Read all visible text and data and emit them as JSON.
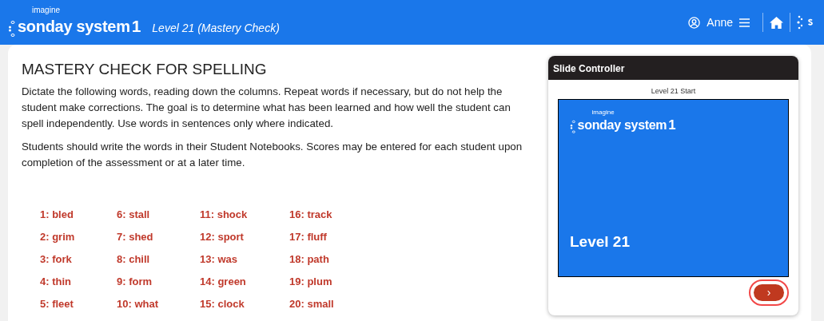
{
  "header": {
    "logo": {
      "tagline": "imagine",
      "name": "sonday system",
      "number": "1"
    },
    "subtitle": "Level 21 (Mastery Check)",
    "user": "Anne"
  },
  "main": {
    "title": "MASTERY CHECK FOR SPELLING",
    "paragraphs": [
      "Dictate the following words, reading down the columns. Repeat words if necessary, but do not help the student make corrections. The goal is to determine what has been learned and how well the student can spell independently. Use words in sentences only where indicated.",
      "Students should write the words in their Student Notebooks. Scores may be entered for each student upon completion of the assessment or at a later time."
    ],
    "word_columns": [
      [
        "1: bled",
        "2: grim",
        "3: fork",
        "4: thin",
        "5: fleet"
      ],
      [
        "6: stall",
        "7: shed",
        "8: chill",
        "9: form",
        "10: what"
      ],
      [
        "11: shock",
        "12: sport",
        "13: was",
        "14: green",
        "15: clock"
      ],
      [
        "16: track",
        "17: fluff",
        "18: path",
        "19: plum",
        "20: small"
      ]
    ]
  },
  "slide_controller": {
    "title": "Slide Controller",
    "caption": "Level 21 Start",
    "slide": {
      "logo": {
        "tagline": "imagine",
        "name": "sonday system",
        "number": "1"
      },
      "heading": "Level 21"
    },
    "next_button": {
      "label": "›",
      "highlighted": true
    }
  }
}
